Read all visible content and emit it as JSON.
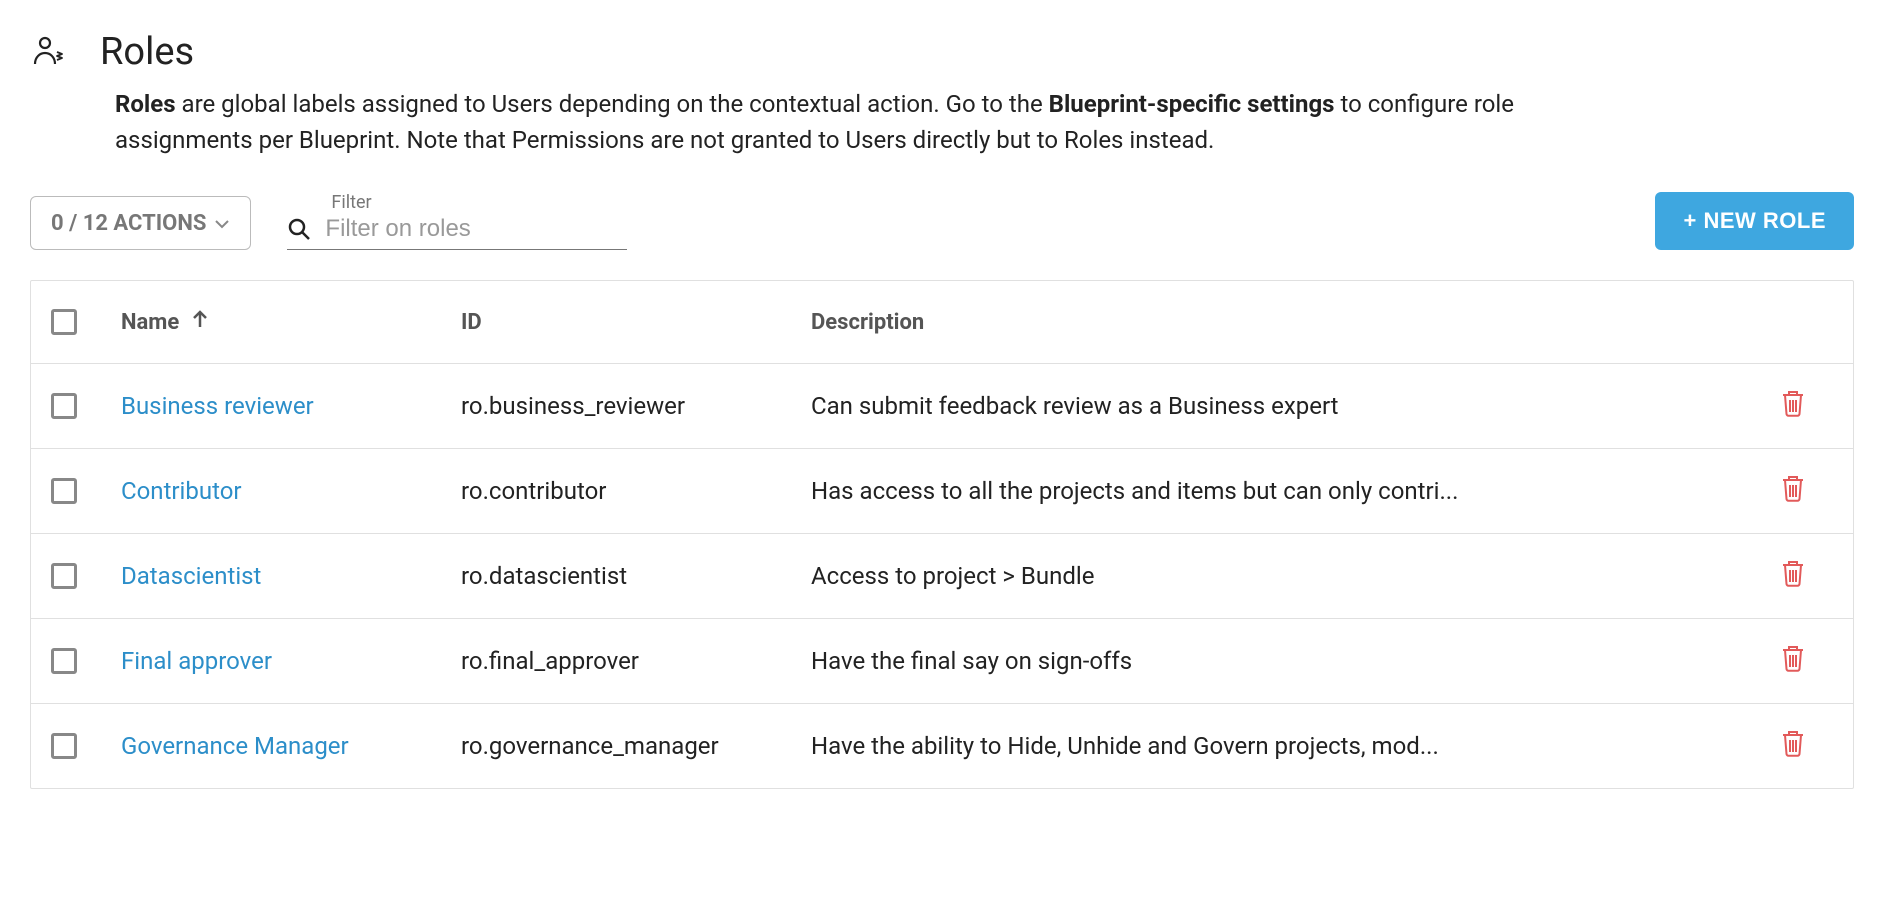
{
  "page": {
    "title": "Roles",
    "subtitle_bold1": "Roles",
    "subtitle_mid1": " are global labels assigned to Users depending on the contextual action. Go to the ",
    "subtitle_bold2": "Blueprint-specific settings",
    "subtitle_mid2": " to configure role assignments per Blueprint. Note that Permissions are not granted to Users directly but to Roles instead."
  },
  "controls": {
    "actions_label": "0 / 12 ACTIONS",
    "filter_label": "Filter",
    "filter_placeholder": "Filter on roles",
    "new_role_label": "+ NEW ROLE"
  },
  "table": {
    "headers": {
      "name": "Name",
      "id": "ID",
      "description": "Description"
    },
    "rows": [
      {
        "name": "Business reviewer",
        "id": "ro.business_reviewer",
        "description": "Can submit feedback review as a Business expert"
      },
      {
        "name": "Contributor",
        "id": "ro.contributor",
        "description": "Has access to all the projects and items but can only contri..."
      },
      {
        "name": "Datascientist",
        "id": "ro.datascientist",
        "description": "Access to project > Bundle"
      },
      {
        "name": "Final approver",
        "id": "ro.final_approver",
        "description": "Have the final say on sign-offs"
      },
      {
        "name": "Governance Manager",
        "id": "ro.governance_manager",
        "description": "Have the ability to Hide, Unhide and Govern projects, mod..."
      }
    ]
  }
}
